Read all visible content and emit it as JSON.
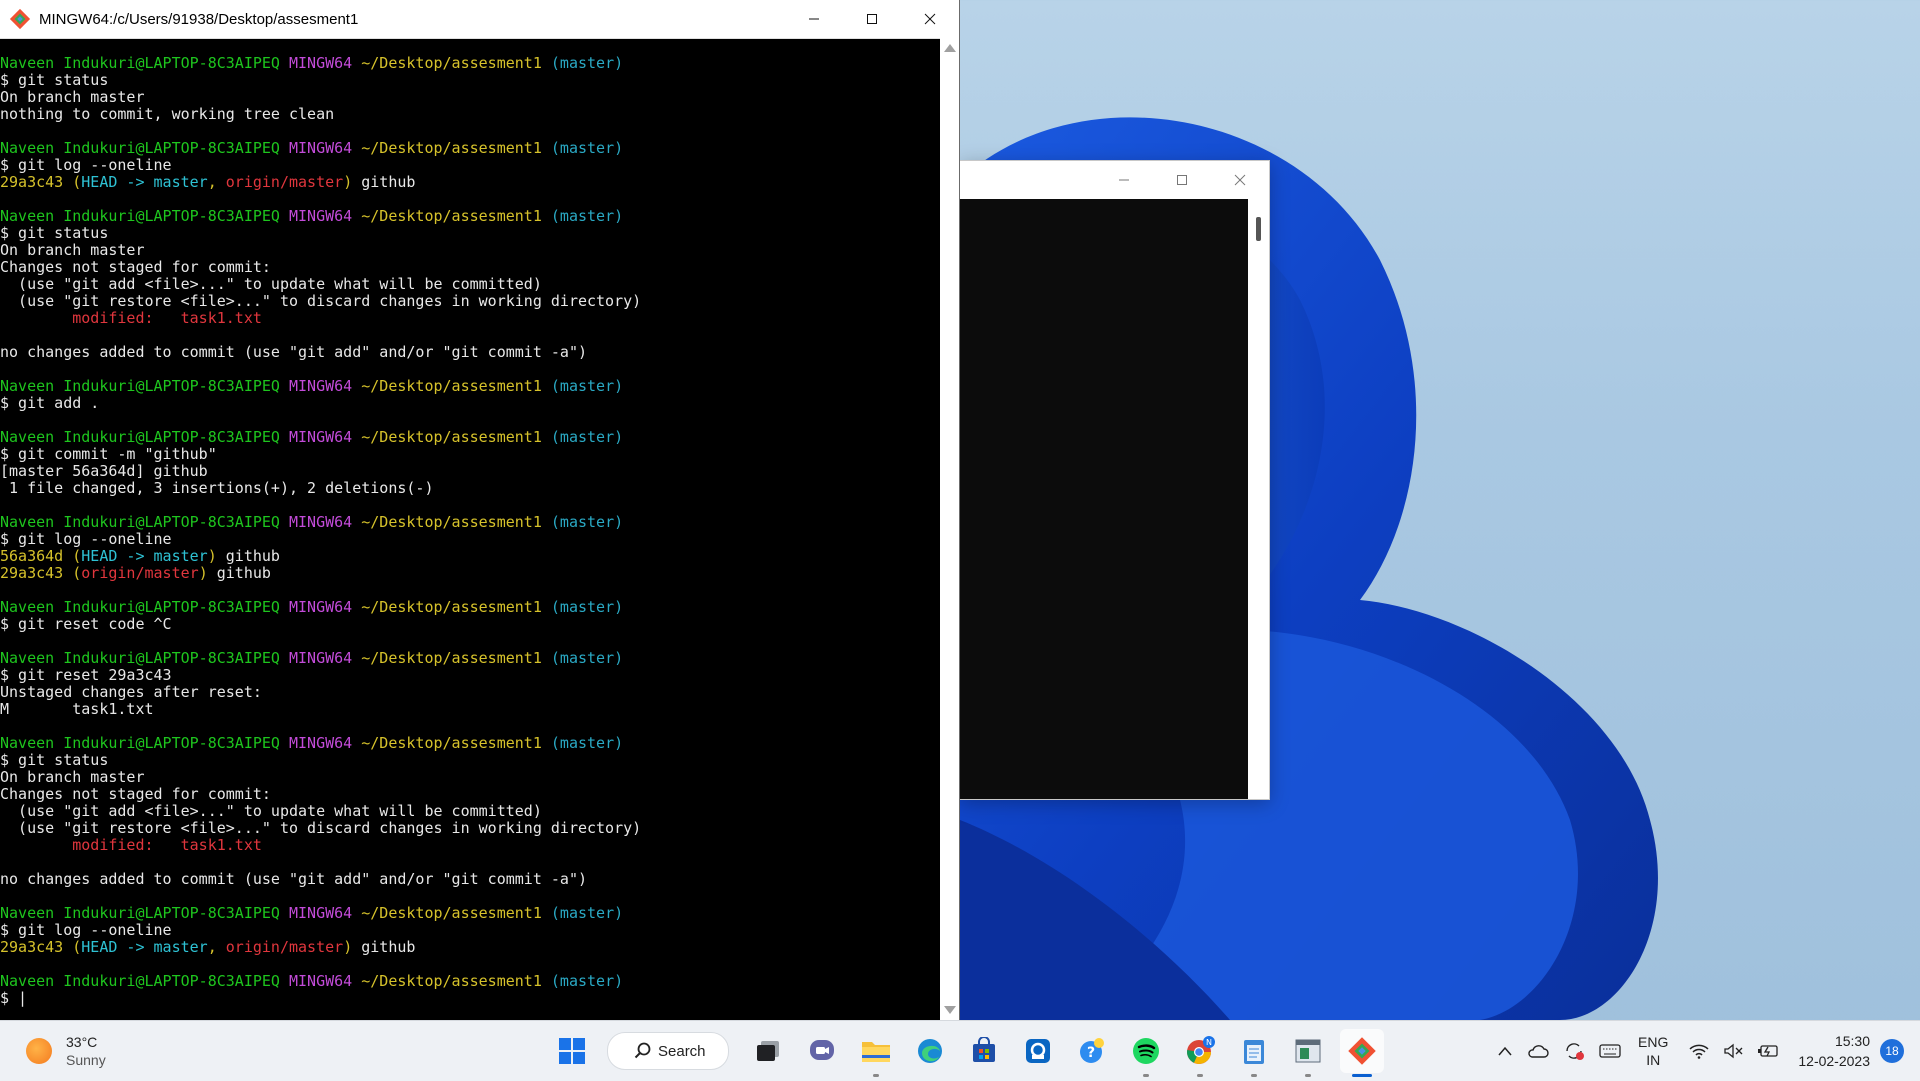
{
  "terminal_window": {
    "title": "MINGW64:/c/Users/91938/Desktop/assesment1",
    "prompt": {
      "user": "Naveen Indukuri@LAPTOP-8C3AIPEQ",
      "host": "MINGW64",
      "path": "~/Desktop/assesment1",
      "branch": "(master)"
    },
    "lines": [
      {
        "kind": "prompt"
      },
      {
        "kind": "text",
        "text": "$ git status"
      },
      {
        "kind": "text",
        "text": "On branch master"
      },
      {
        "kind": "text",
        "text": "nothing to commit, working tree clean"
      },
      {
        "kind": "blank"
      },
      {
        "kind": "prompt"
      },
      {
        "kind": "text",
        "text": "$ git log --oneline"
      },
      {
        "kind": "log",
        "hash": "29a3c43",
        "open": "(",
        "head": "HEAD -> master",
        "sep": ", ",
        "remote": "origin/master",
        "close": ")",
        "msg": " github"
      },
      {
        "kind": "blank"
      },
      {
        "kind": "prompt"
      },
      {
        "kind": "text",
        "text": "$ git status"
      },
      {
        "kind": "text",
        "text": "On branch master"
      },
      {
        "kind": "text",
        "text": "Changes not staged for commit:"
      },
      {
        "kind": "text",
        "text": "  (use \"git add <file>...\" to update what will be committed)"
      },
      {
        "kind": "text",
        "text": "  (use \"git restore <file>...\" to discard changes in working directory)"
      },
      {
        "kind": "modified",
        "text": "        modified:   task1.txt"
      },
      {
        "kind": "blank"
      },
      {
        "kind": "text",
        "text": "no changes added to commit (use \"git add\" and/or \"git commit -a\")"
      },
      {
        "kind": "blank"
      },
      {
        "kind": "prompt"
      },
      {
        "kind": "text",
        "text": "$ git add ."
      },
      {
        "kind": "blank"
      },
      {
        "kind": "prompt"
      },
      {
        "kind": "text",
        "text": "$ git commit -m \"github\""
      },
      {
        "kind": "text",
        "text": "[master 56a364d] github"
      },
      {
        "kind": "text",
        "text": " 1 file changed, 3 insertions(+), 2 deletions(-)"
      },
      {
        "kind": "blank"
      },
      {
        "kind": "prompt"
      },
      {
        "kind": "text",
        "text": "$ git log --oneline"
      },
      {
        "kind": "log",
        "hash": "56a364d",
        "open": "(",
        "head": "HEAD -> master",
        "sep": "",
        "remote": "",
        "close": ")",
        "msg": " github"
      },
      {
        "kind": "log",
        "hash": "29a3c43",
        "open": "(",
        "head": "",
        "sep": "",
        "remote": "origin/master",
        "close": ")",
        "msg": " github"
      },
      {
        "kind": "blank"
      },
      {
        "kind": "prompt"
      },
      {
        "kind": "text",
        "text": "$ git reset code ^C"
      },
      {
        "kind": "blank"
      },
      {
        "kind": "prompt"
      },
      {
        "kind": "text",
        "text": "$ git reset 29a3c43"
      },
      {
        "kind": "text",
        "text": "Unstaged changes after reset:"
      },
      {
        "kind": "text",
        "text": "M       task1.txt"
      },
      {
        "kind": "blank"
      },
      {
        "kind": "prompt"
      },
      {
        "kind": "text",
        "text": "$ git status"
      },
      {
        "kind": "text",
        "text": "On branch master"
      },
      {
        "kind": "text",
        "text": "Changes not staged for commit:"
      },
      {
        "kind": "text",
        "text": "  (use \"git add <file>...\" to update what will be committed)"
      },
      {
        "kind": "text",
        "text": "  (use \"git restore <file>...\" to discard changes in working directory)"
      },
      {
        "kind": "modified",
        "text": "        modified:   task1.txt"
      },
      {
        "kind": "blank"
      },
      {
        "kind": "text",
        "text": "no changes added to commit (use \"git add\" and/or \"git commit -a\")"
      },
      {
        "kind": "blank"
      },
      {
        "kind": "prompt"
      },
      {
        "kind": "text",
        "text": "$ git log --oneline"
      },
      {
        "kind": "log",
        "hash": "29a3c43",
        "open": "(",
        "head": "HEAD -> master",
        "sep": ", ",
        "remote": "origin/master",
        "close": ")",
        "msg": " github"
      },
      {
        "kind": "blank"
      },
      {
        "kind": "prompt"
      },
      {
        "kind": "text",
        "text": "$ |"
      }
    ]
  },
  "taskbar": {
    "weather": {
      "temp": "33°C",
      "condition": "Sunny"
    },
    "search_label": "Search",
    "apps": [
      {
        "name": "start-button",
        "icon": "windows-logo-icon"
      },
      {
        "name": "task-view-button",
        "icon": "task-view-icon"
      },
      {
        "name": "teams-chat-button",
        "icon": "teams-icon"
      },
      {
        "name": "file-explorer-button",
        "icon": "folder-icon"
      },
      {
        "name": "edge-button",
        "icon": "edge-icon"
      },
      {
        "name": "store-button",
        "icon": "store-icon"
      },
      {
        "name": "app-button",
        "icon": "app-icon"
      },
      {
        "name": "help-button",
        "icon": "help-icon"
      },
      {
        "name": "spotify-button",
        "icon": "spotify-icon"
      },
      {
        "name": "chrome-button",
        "icon": "chrome-icon"
      },
      {
        "name": "notepad-button",
        "icon": "notepad-icon"
      },
      {
        "name": "window-app-button",
        "icon": "window-app-icon"
      },
      {
        "name": "git-bash-button",
        "icon": "git-icon"
      }
    ],
    "chrome_badge": "N",
    "lang_line1": "ENG",
    "lang_line2": "IN",
    "time": "15:30",
    "date": "12-02-2023",
    "notifications": "18"
  }
}
